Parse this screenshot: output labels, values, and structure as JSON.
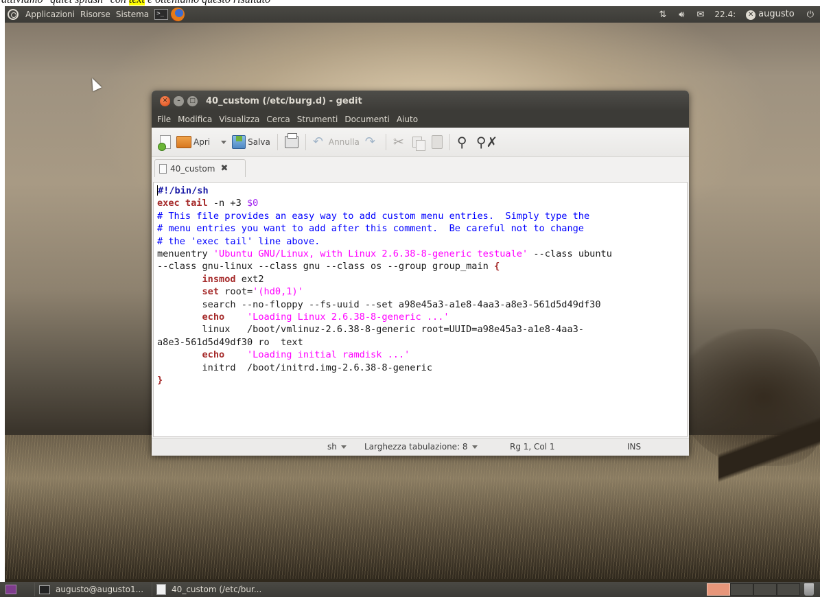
{
  "caption": {
    "before": "attiviamo \"quiet splash\" con ",
    "highlight": "text",
    "after": " e otteniamo questo risultato"
  },
  "top_panel": {
    "menus": [
      "Applicazioni",
      "Risorse",
      "Sistema"
    ],
    "clock": "22.4:",
    "user": "augusto"
  },
  "window": {
    "title": "40_custom (/etc/burg.d) - gedit",
    "menu": [
      "File",
      "Modifica",
      "Visualizza",
      "Cerca",
      "Strumenti",
      "Documenti",
      "Aiuto"
    ],
    "toolbar": {
      "open_label": "Apri",
      "save_label": "Salva",
      "undo_label": "Annulla"
    },
    "tab_label": "40_custom",
    "editor_lines": [
      "#!/bin/sh",
      "exec tail -n +3 $0",
      "# This file provides an easy way to add custom menu entries.  Simply type the",
      "# menu entries you want to add after this comment.  Be careful not to change",
      "# the 'exec tail' line above.",
      "menuentry 'Ubuntu GNU/Linux, with Linux 2.6.38-8-generic testuale' --class ubuntu",
      "--class gnu-linux --class gnu --class os --group group_main {",
      "        insmod ext2",
      "        set root='(hd0,1)'",
      "        search --no-floppy --fs-uuid --set a98e45a3-a1e8-4aa3-a8e3-561d5d49df30",
      "        echo    'Loading Linux 2.6.38-8-generic ...'",
      "        linux   /boot/vmlinuz-2.6.38-8-generic root=UUID=a98e45a3-a1e8-4aa3-",
      "a8e3-561d5d49df30 ro  text",
      "        echo    'Loading initial ramdisk ...'",
      "        initrd  /boot/initrd.img-2.6.38-8-generic",
      "}"
    ],
    "status": {
      "language": "sh",
      "tab_width": "Larghezza tabulazione: 8",
      "position": "Rg 1, Col 1",
      "mode": "INS"
    }
  },
  "bottom_panel": {
    "tasks": [
      "augusto@augusto1...",
      "40_custom (/etc/bur..."
    ]
  },
  "colors": {
    "panel": "#3c3b37",
    "close_button": "#dd4814",
    "comment": "#0000ff",
    "string": "#ff00ff",
    "keyword": "#a52a2a"
  }
}
